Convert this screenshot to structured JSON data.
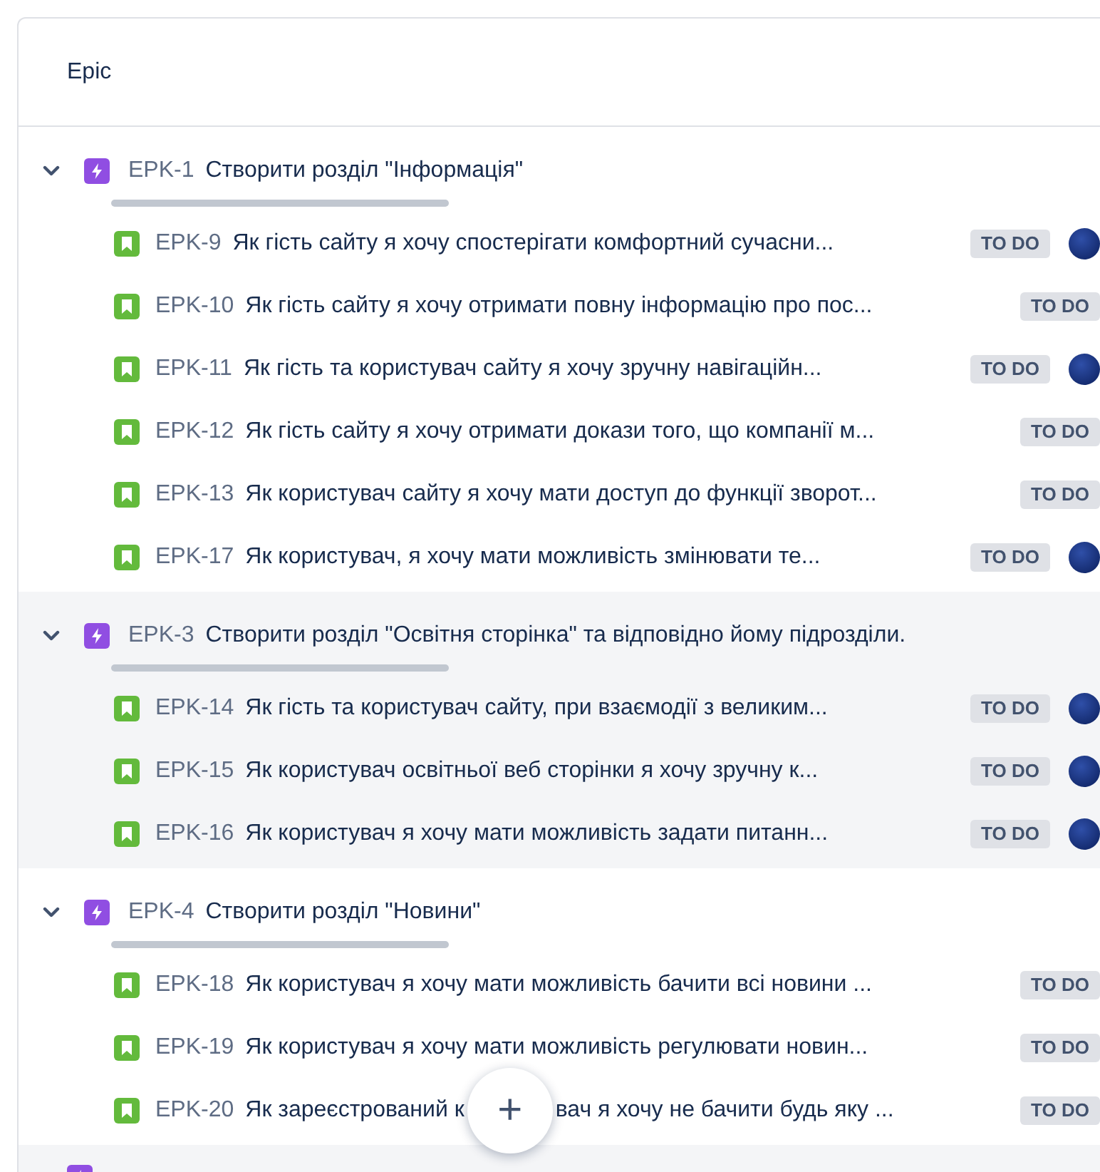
{
  "header": {
    "column": "Epic"
  },
  "epics": [
    {
      "kind": "epic",
      "key": "EPK-1",
      "title": "Створити розділ \"Інформація\"",
      "expanded": true,
      "progress": {
        "level": 0
      },
      "stories": [
        {
          "key": "EPK-9",
          "summary": [
            "Як гість сайту я хочу спостерігати комфортний сучасни..."
          ],
          "status": "TO DO",
          "assigned": true
        },
        {
          "key": "EPK-10",
          "summary": [
            "Як гість сайту я хочу отримати повну інформацію про пос..."
          ],
          "status": "TO DO",
          "assigned": false
        },
        {
          "key": "EPK-11",
          "summary": [
            "Як гість та користувач сайту я хочу зручну навігаційн..."
          ],
          "status": "TO DO",
          "assigned": true
        },
        {
          "key": "EPK-12",
          "summary": [
            "Як гість сайту я хочу отримати докази того, що компанії м..."
          ],
          "status": "TO DO",
          "assigned": false
        },
        {
          "key": "EPK-13",
          "summary": [
            "Як користувач сайту я хочу мати доступ до функції зворот..."
          ],
          "status": "TO DO",
          "assigned": false
        },
        {
          "key": "EPK-17",
          "summary": [
            "Як користувач, я хочу мати можливість змінювати те..."
          ],
          "status": "TO DO",
          "assigned": true
        }
      ]
    },
    {
      "kind": "epic",
      "key": "EPK-3",
      "title": "Створити розділ \"Освітня сторінка\" та відповідно йому підрозділи.",
      "expanded": true,
      "progress": {
        "level": 0
      },
      "stories": [
        {
          "key": "EPK-14",
          "summary": [
            "Як гість та користувач сайту, при взаємодії з великим..."
          ],
          "status": "TO DO",
          "assigned": true
        },
        {
          "key": "EPK-15",
          "summary": [
            "Як користувач освітньої веб сторінки я хочу зручну к..."
          ],
          "status": "TO DO",
          "assigned": true
        },
        {
          "key": "EPK-16",
          "summary": [
            "Як користувач я хочу мати можливість задати питанн..."
          ],
          "status": "TO DO",
          "assigned": true
        }
      ]
    },
    {
      "kind": "epic",
      "key": "EPK-4",
      "title": "Створити розділ \"Новини\"",
      "expanded": true,
      "progress": {
        "level": 0
      },
      "stories": [
        {
          "key": "EPK-18",
          "summary": [
            "Як користувач я хочу мати можливість бачити всі новини ..."
          ],
          "status": "TO DO",
          "assigned": false
        },
        {
          "key": "EPK-19",
          "summary": [
            "Як користувач я хочу мати можливість регулювати новин..."
          ],
          "status": "TO DO",
          "assigned": false
        },
        {
          "key": "EPK-20",
          "summary": [
            "Як зареєстрований к",
            "вач я хочу не бачити будь яку ..."
          ],
          "status": "TO DO",
          "assigned": false
        }
      ]
    },
    {
      "kind": "cut_off"
    }
  ],
  "create_button": {
    "label": "+"
  }
}
